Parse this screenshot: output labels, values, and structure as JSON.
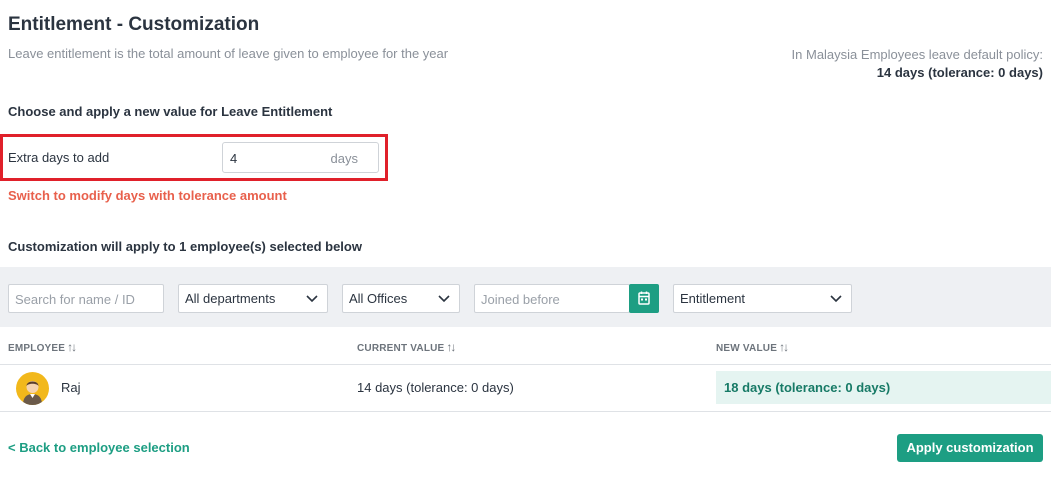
{
  "header": {
    "title": "Entitlement - Customization",
    "subtitle": "Leave entitlement is the total amount of leave given to employee for the year",
    "policy_line1": "In Malaysia Employees leave default policy:",
    "policy_line2": "14 days (tolerance: 0 days)"
  },
  "form": {
    "choose_label": "Choose and apply a new value for Leave Entitlement",
    "extra_days_label": "Extra days to add",
    "extra_days_value": "4",
    "extra_days_unit": "days",
    "switch_link": "Switch to modify days with tolerance amount",
    "apply_note": "Customization will apply to 1 employee(s) selected below"
  },
  "filters": {
    "search_placeholder": "Search for name / ID",
    "department": "All departments",
    "office": "All Offices",
    "joined_placeholder": "Joined before",
    "type": "Entitlement"
  },
  "table": {
    "columns": [
      "EMPLOYEE",
      "CURRENT VALUE",
      "NEW VALUE"
    ],
    "sort_glyph": "↑↓",
    "rows": [
      {
        "name": "Raj",
        "current": "14 days (tolerance: 0 days)",
        "new": "18 days (tolerance: 0 days)"
      }
    ]
  },
  "footer": {
    "back_link": "< Back to employee selection",
    "apply_button": "Apply customization"
  },
  "colors": {
    "accent": "#1d9e83",
    "warning_link": "#e8604c",
    "highlight_border": "#e0202a"
  },
  "icons": {
    "calendar": "calendar-icon",
    "chevron": "chevron-down-icon",
    "sort": "sort-icon",
    "avatar": "avatar-icon"
  }
}
